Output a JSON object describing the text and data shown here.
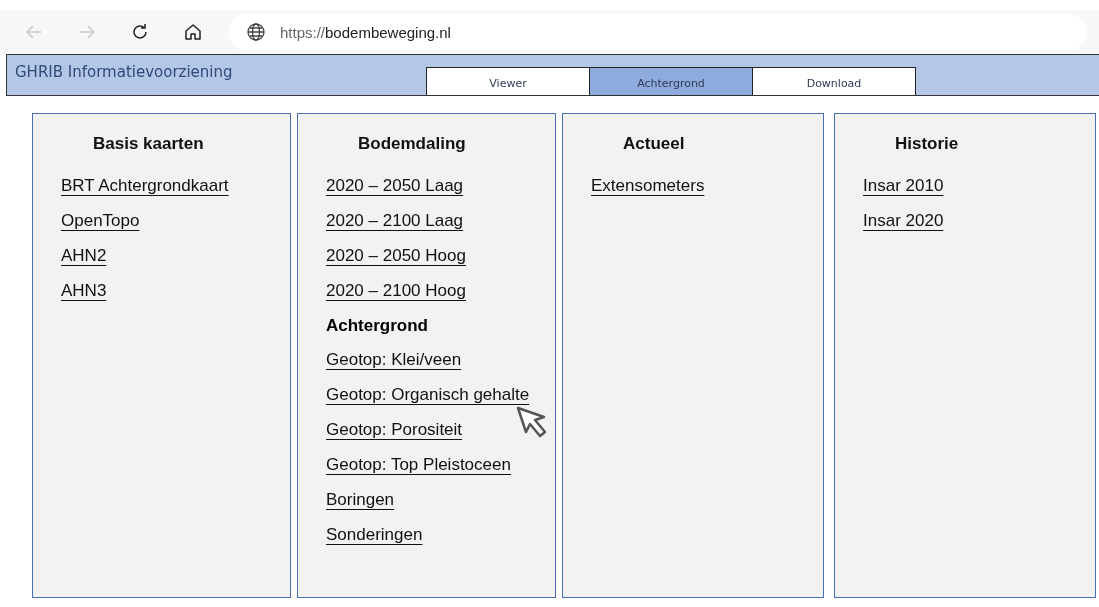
{
  "browser": {
    "url_prefix": "https://",
    "url_domain": "bodembeweging.nl"
  },
  "header": {
    "title": "GHRIB Informatievoorziening"
  },
  "tabs": [
    {
      "label": "Viewer",
      "selected": false
    },
    {
      "label": "Achtergrond",
      "selected": true
    },
    {
      "label": "Download",
      "selected": false
    }
  ],
  "panels": [
    {
      "title": "Basis kaarten",
      "items": [
        {
          "kind": "link",
          "label": "BRT Achtergrondkaart"
        },
        {
          "kind": "link",
          "label": "OpenTopo"
        },
        {
          "kind": "link",
          "label": "AHN2"
        },
        {
          "kind": "link",
          "label": "AHN3"
        }
      ]
    },
    {
      "title": "Bodemdaling",
      "items": [
        {
          "kind": "link",
          "label": "2020 – 2050 Laag"
        },
        {
          "kind": "link",
          "label": "2020 – 2100 Laag"
        },
        {
          "kind": "link",
          "label": "2020 – 2050 Hoog"
        },
        {
          "kind": "link",
          "label": "2020 – 2100 Hoog"
        },
        {
          "kind": "heading",
          "label": "Achtergrond"
        },
        {
          "kind": "link",
          "label": "Geotop: Klei/veen"
        },
        {
          "kind": "link",
          "label": "Geotop: Organisch gehalte",
          "hovered": true
        },
        {
          "kind": "link",
          "label": "Geotop: Porositeit"
        },
        {
          "kind": "link",
          "label": "Geotop: Top Pleistoceen"
        },
        {
          "kind": "link",
          "label": "Boringen"
        },
        {
          "kind": "link",
          "label": "Sonderingen"
        }
      ]
    },
    {
      "title": "Actueel",
      "items": [
        {
          "kind": "link",
          "label": "Extensometers"
        }
      ]
    },
    {
      "title": "Historie",
      "items": [
        {
          "kind": "link",
          "label": "Insar 2010"
        },
        {
          "kind": "link",
          "label": "Insar 2020"
        }
      ]
    }
  ]
}
